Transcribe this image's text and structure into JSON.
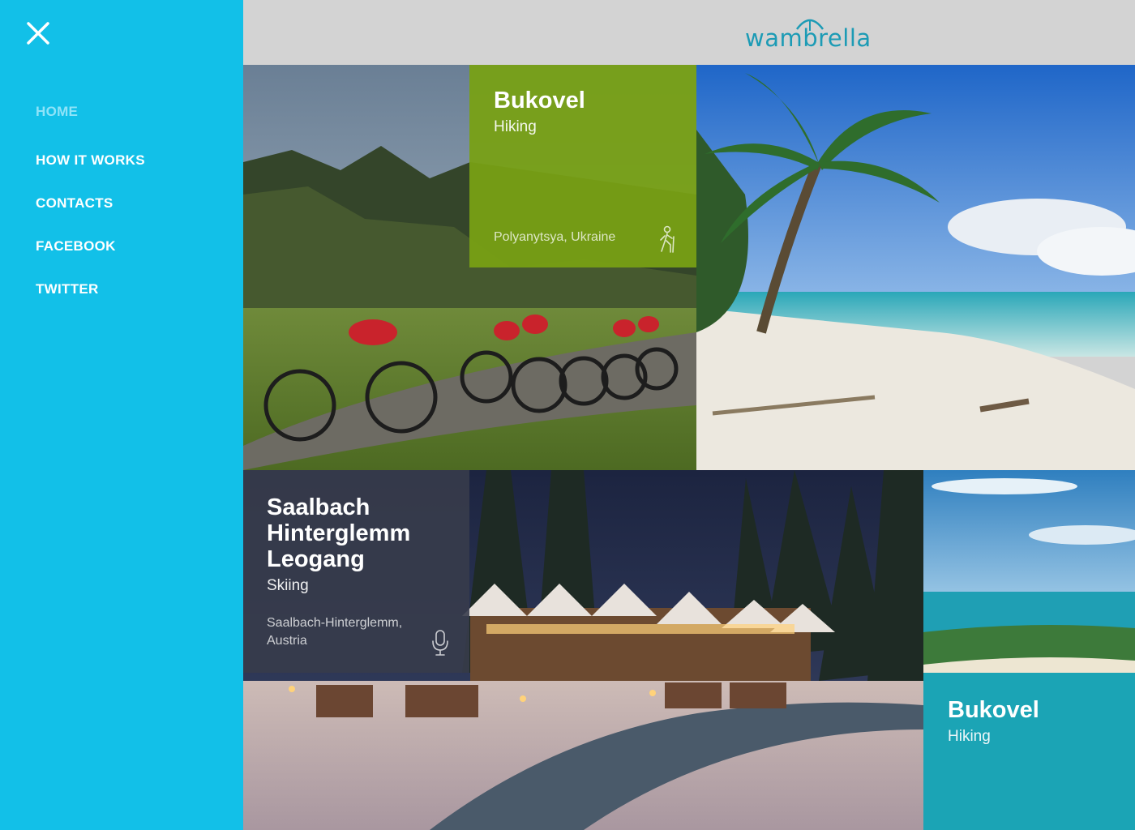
{
  "brand": {
    "logo_text": "wambrella",
    "color": "#1c9bb5"
  },
  "sidebar": {
    "background": "#12c0e8",
    "close_icon": "close-icon",
    "items": [
      {
        "label": "HOME",
        "active": true
      },
      {
        "label": "HOW IT WORKS"
      },
      {
        "label": "CONTACTS"
      },
      {
        "label": "FACEBOOK"
      },
      {
        "label": "TWITTER"
      }
    ]
  },
  "cards": [
    {
      "title": "Bukovel",
      "activity": "Hiking",
      "location": "Polyanytsya, Ukraine",
      "icon": "hiker-icon",
      "color": "#78a014"
    },
    {
      "title": "Saalbach Hinterglemm Leogang",
      "activity": "Skiing",
      "location": "Saalbach-Hinterglemm, Austria",
      "icon": "microphone-icon",
      "color": "#373c4b"
    },
    {
      "title": "Bukovel",
      "activity": "Hiking",
      "color": "#1ba3b4"
    }
  ]
}
